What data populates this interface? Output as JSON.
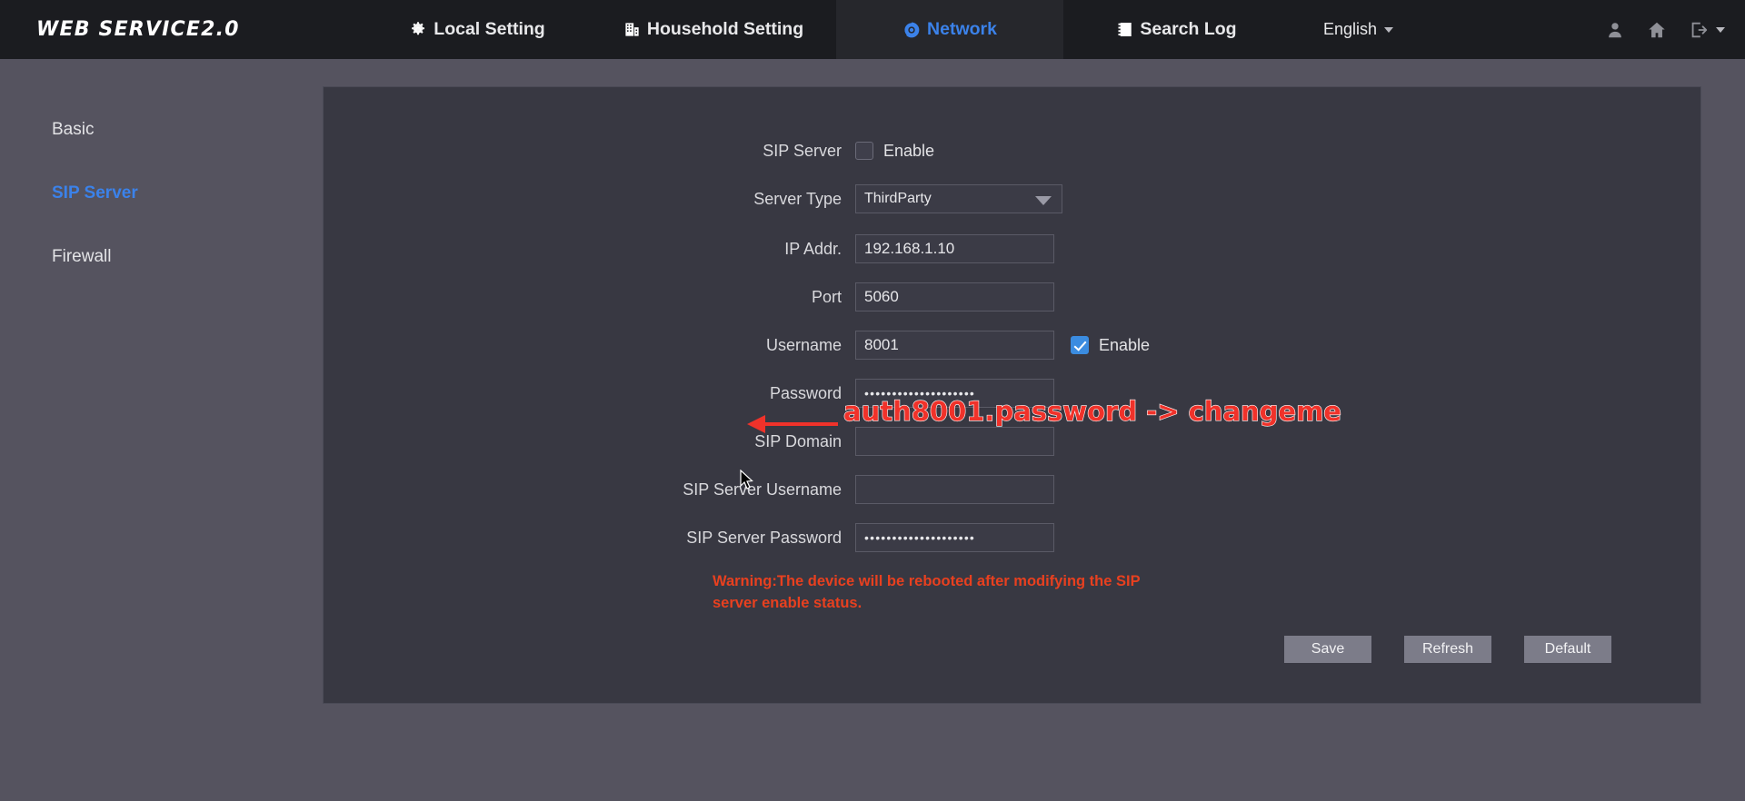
{
  "header": {
    "brand": "WEB SERVICE2.0",
    "nav": [
      {
        "label": "Local Setting",
        "icon": "gear-icon",
        "active": false
      },
      {
        "label": "Household Setting",
        "icon": "building-icon",
        "active": false
      },
      {
        "label": "Network",
        "icon": "globe-icon",
        "active": true
      },
      {
        "label": "Search Log",
        "icon": "log-book-icon",
        "active": false
      }
    ],
    "language": "English",
    "right_icons": [
      "user-icon",
      "home-icon",
      "logout-icon"
    ]
  },
  "sidebar": {
    "items": [
      {
        "label": "Basic",
        "active": false
      },
      {
        "label": "SIP Server",
        "active": true
      },
      {
        "label": "Firewall",
        "active": false
      }
    ]
  },
  "form": {
    "sip_server": {
      "label": "SIP Server",
      "enable_label": "Enable",
      "checked": false
    },
    "server_type": {
      "label": "Server Type",
      "value": "ThirdParty"
    },
    "ip_addr": {
      "label": "IP Addr.",
      "value": "192.168.1.10",
      "placeholder": ""
    },
    "port": {
      "label": "Port",
      "value": "5060",
      "placeholder": ""
    },
    "username": {
      "label": "Username",
      "value": "8001",
      "placeholder": "",
      "enable_label": "Enable",
      "checked": true
    },
    "password": {
      "label": "Password",
      "value": "••••••••••••••••••••",
      "placeholder": ""
    },
    "sip_domain": {
      "label": "SIP Domain",
      "value": "",
      "placeholder": ""
    },
    "sip_server_username": {
      "label": "SIP Server Username",
      "value": "",
      "placeholder": ""
    },
    "sip_server_password": {
      "label": "SIP Server Password",
      "value": "••••••••••••••••••••",
      "placeholder": ""
    },
    "warning": "Warning:The device will be rebooted after modifying the SIP server enable status."
  },
  "buttons": {
    "save": "Save",
    "refresh": "Refresh",
    "default": "Default"
  },
  "annotation": {
    "text": "auth8001.password -> changeme",
    "color": "#f0322a"
  },
  "colors": {
    "page_background": "#55535f",
    "panel_background": "#383842",
    "topbar_background": "#1b1c20",
    "active_tab_background": "#26272c",
    "accent_blue": "#3b82ea",
    "warning_red": "#e8401f",
    "button_grey": "#7c7c89"
  }
}
